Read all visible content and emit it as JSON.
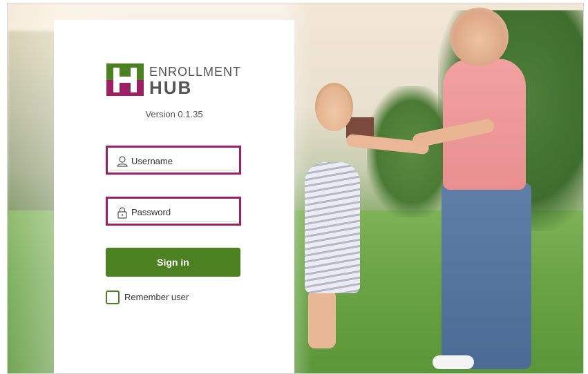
{
  "app": {
    "logo_top": "ENROLLMENT",
    "logo_bottom": "HUB",
    "version": "Version 0.1.35"
  },
  "login": {
    "username_placeholder": "Username",
    "password_placeholder": "Password",
    "signin_label": "Sign in",
    "remember_label": "Remember user",
    "remember_checked": false
  },
  "colors": {
    "brand_magenta": "#9e1f63",
    "brand_green": "#4b8120",
    "text": "#555555"
  },
  "icons": {
    "username": "user-icon",
    "password": "lock-icon"
  }
}
